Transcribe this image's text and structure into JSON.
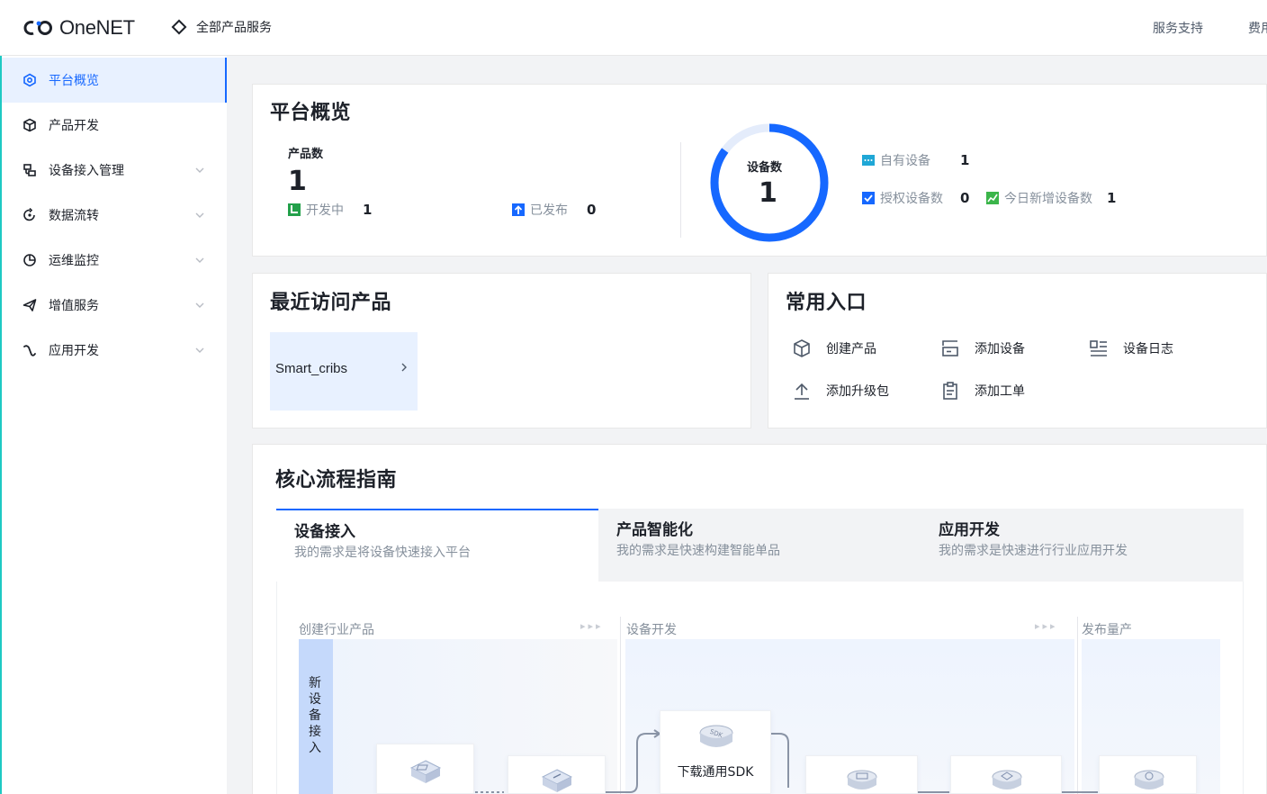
{
  "header": {
    "logo_text": "OneNET",
    "all_products": "全部产品服务",
    "support": "服务支持",
    "cut_link": "费用"
  },
  "sidebar": {
    "items": [
      {
        "label": "平台概览",
        "active": true
      },
      {
        "label": "产品开发",
        "expandable": false
      },
      {
        "label": "设备接入管理",
        "expandable": true
      },
      {
        "label": "数据流转",
        "expandable": true
      },
      {
        "label": "运维监控",
        "expandable": true
      },
      {
        "label": "增值服务",
        "expandable": true
      },
      {
        "label": "应用开发",
        "expandable": true
      }
    ]
  },
  "overview": {
    "title": "平台概览",
    "product_count_label": "产品数",
    "product_count": "1",
    "developing_label": "开发中",
    "developing_count": "1",
    "published_label": "已发布",
    "published_count": "0",
    "device_count_label": "设备数",
    "device_count": "1",
    "own_devices_label": "自有设备",
    "own_devices_count": "1",
    "authorized_label": "授权设备数",
    "authorized_count": "0",
    "new_today_label": "今日新增设备数",
    "new_today_count": "1",
    "ring_fill_fraction": 0.85
  },
  "recent": {
    "title": "最近访问产品",
    "items": [
      {
        "name": "Smart_cribs"
      }
    ]
  },
  "quick_entry": {
    "title": "常用入口",
    "items": [
      {
        "label": "创建产品",
        "icon": "cube-icon"
      },
      {
        "label": "添加设备",
        "icon": "add-device-icon"
      },
      {
        "label": "设备日志",
        "icon": "log-icon"
      },
      {
        "label": "添加升级包",
        "icon": "upload-icon"
      },
      {
        "label": "添加工单",
        "icon": "clipboard-icon"
      }
    ]
  },
  "guide": {
    "title": "核心流程指南",
    "tabs": [
      {
        "title": "设备接入",
        "subtitle": "我的需求是将设备快速接入平台",
        "active": true
      },
      {
        "title": "产品智能化",
        "subtitle": "我的需求是快速构建智能单品",
        "active": false
      },
      {
        "title": "应用开发",
        "subtitle": "我的需求是快速进行行业应用开发",
        "active": false
      }
    ],
    "stages": [
      "创建行业产品",
      "设备开发",
      "发布量产"
    ],
    "lane_label": "新设备接入",
    "steps": [
      {
        "label": "下载通用SDK"
      }
    ]
  },
  "colors": {
    "primary": "#1668ff",
    "sidebar_accent": "#1ec9c3",
    "developing_green": "#23a04a",
    "new_today_green": "#3bb54a",
    "own_device_teal": "#1fa7d6"
  }
}
